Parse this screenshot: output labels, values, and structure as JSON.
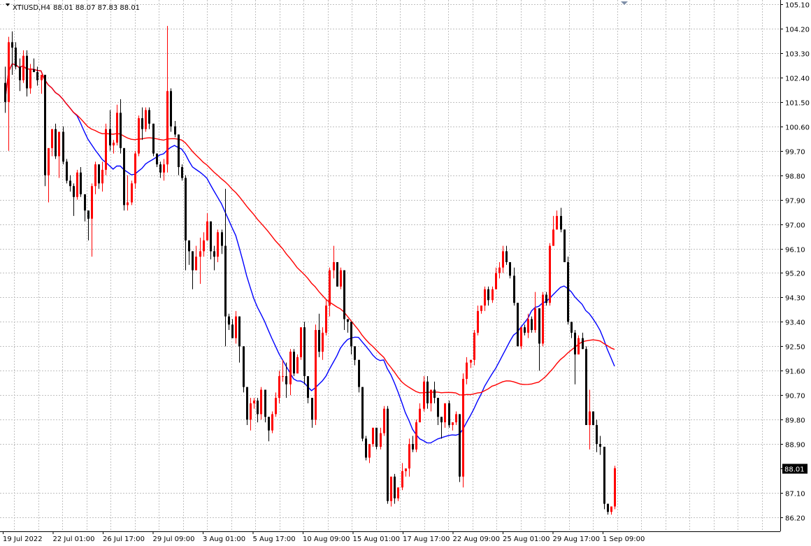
{
  "header": {
    "symbol": "XTIUSD,H4",
    "ohlc": "88.01 88.07 87.83 88.01"
  },
  "colors": {
    "background": "#ffffff",
    "grid": "#c0c0c0",
    "axis": "#000000",
    "bull": "#ff0000",
    "bear": "#000000",
    "ma_fast": "#0000ff",
    "ma_slow": "#ff0000",
    "price_box": "#000000"
  },
  "chart_data": {
    "type": "candlestick",
    "symbol": "XTIUSD",
    "timeframe": "H4",
    "y_ticks": [
      "105.10",
      "104.20",
      "103.30",
      "102.40",
      "101.50",
      "100.60",
      "99.70",
      "98.80",
      "97.90",
      "97.00",
      "96.10",
      "95.20",
      "94.30",
      "93.40",
      "92.50",
      "91.60",
      "90.70",
      "89.80",
      "88.90",
      "88.01",
      "87.10",
      "86.20"
    ],
    "ylim": [
      85.85,
      105.1
    ],
    "x_ticks": [
      "19 Jul 2022",
      "22 Jul 01:00",
      "26 Jul 17:00",
      "29 Jul 09:00",
      "3 Aug 01:00",
      "5 Aug 17:00",
      "10 Aug 09:00",
      "15 Aug 01:00",
      "17 Aug 17:00",
      "22 Aug 09:00",
      "25 Aug 01:00",
      "29 Aug 17:00",
      "1 Sep 09:00"
    ],
    "current_price": "88.01",
    "candles": {
      "open": [
        102.2,
        101.5,
        103.7,
        103.5,
        102.8,
        102.3,
        103.2,
        102.0,
        102.7,
        102.6,
        102.3,
        102.5,
        98.8,
        99.8,
        100.5,
        99.5,
        100.4,
        99.3,
        98.6,
        98.4,
        98.0,
        98.9,
        98.1,
        97.5,
        97.2,
        98.4,
        99.2,
        98.5,
        99.0,
        100.5,
        99.9,
        100.0,
        101.1,
        99.8,
        97.7,
        97.8,
        98.5,
        99.6,
        100.9,
        100.5,
        101.2,
        100.7,
        99.6,
        99.2,
        98.9,
        99.2,
        101.9,
        100.6,
        100.3,
        99.1,
        98.7,
        96.4,
        96.0,
        95.3,
        95.8,
        96.0,
        96.4,
        97.1,
        96.0,
        95.8,
        96.7,
        96.2,
        93.6,
        93.3,
        92.8,
        93.6,
        92.5,
        91.0,
        89.8,
        90.4,
        90.5,
        90.0,
        90.9,
        89.9,
        89.4,
        90.0,
        90.6,
        91.4,
        91.4,
        91.1,
        92.3,
        91.5,
        92.1,
        93.2,
        91.4,
        90.6,
        89.8,
        93.1,
        92.3,
        93.0,
        94.0,
        95.3,
        95.6,
        94.7,
        95.3,
        93.5,
        93.4,
        92.5,
        92.0,
        91.0,
        89.1,
        88.4,
        88.9,
        89.5,
        88.8,
        89.3,
        90.2,
        86.8,
        87.7,
        86.9,
        87.3,
        87.9,
        88.0,
        88.9,
        88.7,
        89.7,
        90.2,
        91.2,
        90.4,
        90.9,
        90.6,
        89.9,
        89.7,
        90.4,
        89.6,
        89.7,
        90.0,
        87.7,
        91.3,
        91.9,
        92.0,
        93.0,
        93.8,
        94.0,
        94.6,
        94.2,
        94.6,
        95.2,
        95.4,
        96.0,
        95.6,
        95.1,
        94.1,
        92.5,
        93.2,
        93.0,
        93.5,
        93.1,
        93.9,
        92.6,
        94.4,
        94.1,
        96.2,
        96.8,
        97.3,
        96.8,
        95.6,
        93.4,
        93.0,
        92.2,
        92.8,
        92.4,
        89.6,
        90.1,
        89.6,
        88.9,
        88.8,
        86.7,
        86.4,
        86.6
      ],
      "high": [
        102.8,
        103.9,
        104.1,
        103.7,
        103.1,
        103.4,
        103.4,
        102.9,
        103.1,
        102.8,
        102.4,
        102.5,
        99.2,
        100.5,
        100.7,
        99.8,
        100.6,
        99.4,
        98.8,
        98.5,
        99.0,
        99.1,
        98.1,
        97.5,
        98.5,
        99.3,
        99.2,
        99.3,
        100.7,
        101.2,
        100.1,
        101.4,
        101.6,
        99.8,
        98.8,
        98.6,
        99.7,
        101.0,
        101.3,
        101.3,
        101.3,
        100.7,
        99.6,
        99.3,
        99.4,
        104.3,
        102.0,
        100.8,
        100.3,
        99.2,
        98.8,
        96.4,
        96.0,
        96.2,
        96.5,
        96.7,
        97.4,
        97.1,
        96.2,
        96.8,
        96.8,
        98.3,
        93.7,
        93.5,
        93.8,
        93.6,
        92.5,
        91.0,
        90.6,
        90.6,
        90.6,
        91.0,
        90.9,
        89.9,
        90.1,
        90.8,
        91.6,
        92.0,
        91.9,
        92.4,
        92.4,
        92.2,
        93.2,
        93.4,
        91.4,
        90.6,
        93.3,
        93.7,
        93.2,
        94.2,
        95.4,
        96.2,
        95.6,
        95.4,
        95.3,
        93.5,
        93.4,
        92.5,
        92.0,
        91.0,
        89.2,
        88.9,
        89.5,
        89.5,
        89.5,
        90.3,
        90.3,
        86.9,
        87.8,
        87.3,
        88.2,
        88.0,
        89.1,
        89.2,
        89.8,
        90.4,
        91.4,
        91.4,
        90.9,
        91.2,
        90.6,
        89.9,
        90.4,
        90.5,
        89.7,
        90.1,
        90.0,
        91.5,
        92.1,
        92.0,
        93.1,
        94.0,
        94.0,
        94.7,
        94.7,
        94.7,
        95.4,
        95.6,
        96.2,
        96.2,
        95.6,
        95.4,
        94.1,
        93.2,
        93.3,
        93.7,
        93.6,
        94.5,
        93.9,
        94.5,
        94.5,
        96.3,
        97.3,
        97.5,
        97.6,
        96.8,
        95.8,
        93.4,
        93.1,
        92.9,
        93.0,
        92.5,
        90.9,
        90.1,
        89.8,
        89.2,
        88.8,
        86.7,
        86.5,
        88.1
      ],
      "low": [
        101.1,
        99.7,
        102.5,
        102.7,
        101.9,
        102.2,
        101.7,
        101.8,
        102.6,
        102.1,
        101.8,
        98.4,
        97.8,
        99.5,
        99.4,
        98.7,
        99.2,
        98.5,
        98.2,
        97.3,
        97.9,
        98.0,
        97.1,
        96.4,
        95.8,
        98.1,
        98.3,
        98.2,
        98.8,
        99.7,
        99.6,
        99.9,
        99.6,
        97.5,
        97.5,
        97.7,
        98.3,
        99.5,
        100.1,
        100.4,
        100.5,
        99.5,
        99.1,
        98.7,
        98.6,
        98.9,
        100.4,
        100.2,
        98.8,
        98.6,
        95.3,
        95.5,
        94.6,
        95.3,
        94.8,
        95.8,
        96.4,
        95.7,
        95.3,
        95.6,
        95.9,
        92.5,
        93.1,
        92.8,
        92.6,
        91.9,
        90.8,
        89.6,
        89.4,
        90.2,
        89.7,
        89.8,
        89.7,
        89.0,
        89.3,
        89.9,
        90.4,
        91.2,
        90.6,
        90.7,
        91.4,
        91.5,
        92.0,
        91.1,
        90.4,
        89.5,
        89.6,
        92.1,
        92.0,
        92.9,
        93.6,
        95.0,
        94.7,
        94.6,
        93.1,
        93.0,
        92.2,
        91.8,
        90.8,
        89.0,
        88.3,
        88.2,
        88.8,
        88.7,
        88.7,
        89.2,
        86.7,
        86.6,
        86.7,
        86.8,
        87.2,
        87.7,
        87.7,
        88.6,
        88.6,
        89.7,
        90.1,
        90.2,
        90.1,
        90.4,
        89.6,
        89.1,
        89.5,
        89.5,
        89.4,
        89.6,
        87.5,
        87.3,
        91.1,
        91.7,
        91.8,
        92.9,
        93.7,
        93.8,
        94.0,
        94.1,
        94.6,
        95.0,
        95.2,
        95.5,
        95.0,
        94.0,
        92.6,
        92.4,
        92.9,
        92.8,
        93.0,
        93.0,
        91.6,
        92.5,
        94.0,
        94.0,
        96.2,
        96.8,
        96.7,
        95.6,
        93.3,
        92.8,
        91.1,
        92.2,
        92.4,
        89.8,
        88.7,
        89.6,
        88.6,
        88.5,
        86.5,
        86.3,
        86.3,
        86.5
      ],
      "close": [
        101.5,
        103.7,
        103.5,
        102.8,
        102.3,
        103.2,
        102.0,
        102.7,
        102.6,
        102.3,
        102.5,
        98.8,
        99.8,
        100.5,
        99.5,
        100.4,
        99.3,
        98.6,
        98.4,
        98.0,
        98.9,
        98.1,
        97.5,
        97.2,
        98.4,
        99.2,
        98.5,
        99.0,
        100.5,
        99.9,
        100.0,
        101.1,
        99.8,
        97.7,
        97.8,
        98.5,
        99.6,
        100.9,
        100.5,
        101.2,
        100.7,
        99.6,
        99.2,
        98.9,
        99.2,
        101.9,
        100.6,
        100.3,
        99.1,
        98.7,
        96.4,
        96.0,
        95.3,
        95.8,
        96.0,
        96.4,
        97.1,
        96.0,
        95.8,
        96.7,
        96.2,
        93.6,
        93.3,
        92.8,
        93.6,
        92.5,
        91.0,
        89.8,
        90.4,
        90.5,
        90.0,
        90.9,
        89.9,
        89.4,
        90.0,
        90.6,
        91.4,
        91.4,
        91.1,
        92.3,
        91.5,
        92.1,
        93.2,
        91.4,
        90.6,
        89.8,
        93.1,
        92.3,
        93.0,
        94.0,
        95.3,
        95.6,
        94.7,
        95.3,
        93.5,
        93.4,
        92.5,
        92.0,
        91.0,
        89.1,
        88.4,
        88.9,
        89.5,
        88.8,
        89.3,
        90.2,
        86.8,
        87.7,
        86.9,
        87.3,
        87.9,
        88.0,
        88.9,
        88.7,
        89.7,
        90.2,
        91.2,
        90.4,
        90.9,
        90.6,
        89.9,
        89.7,
        90.4,
        89.6,
        89.7,
        90.0,
        87.7,
        91.3,
        91.9,
        92.0,
        93.0,
        93.8,
        94.0,
        94.6,
        94.2,
        94.6,
        95.2,
        95.4,
        96.0,
        95.6,
        95.1,
        94.1,
        92.5,
        93.2,
        93.0,
        93.5,
        93.1,
        93.9,
        92.6,
        94.4,
        94.1,
        96.2,
        96.8,
        97.3,
        96.8,
        95.6,
        93.4,
        93.0,
        92.2,
        92.8,
        92.4,
        89.6,
        90.1,
        89.6,
        88.9,
        88.8,
        86.7,
        86.4,
        86.6,
        88.01
      ]
    },
    "moving_averages": [
      {
        "period": 20,
        "color": "#0000ff"
      },
      {
        "period": 50,
        "color": "#ff0000"
      }
    ],
    "grid": true,
    "legend": "none"
  }
}
